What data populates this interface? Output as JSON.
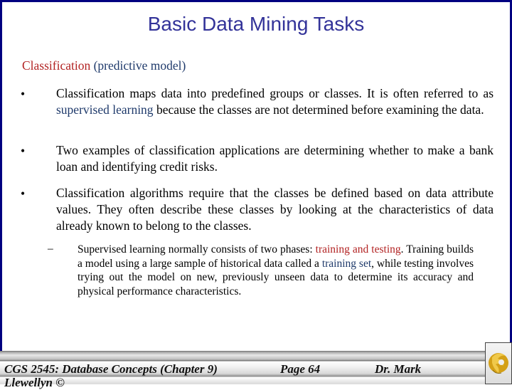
{
  "slide": {
    "title": "Basic Data Mining Tasks",
    "subtitle": {
      "term": "Classification",
      "qualifier": "(predictive model)"
    },
    "bullets": [
      {
        "symbol": "•",
        "before": "Classification maps data into predefined groups or classes.  It is often referred to as ",
        "highlight": "supervised learning",
        "after": " because the classes are not determined before examining the data."
      },
      {
        "symbol": "•",
        "text": "Two examples of classification applications are determining whether to make a bank loan and identifying credit risks."
      },
      {
        "symbol": "•",
        "text": "Classification algorithms require that the classes be defined based on data attribute values.  They often describe these classes by looking at the characteristics of data already known to belong to the classes."
      }
    ],
    "sub_bullet": {
      "symbol": "–",
      "part1": "Supervised learning normally consists of two phases: ",
      "highlight1": "training and testing",
      "part2": ".  Training builds a model using a large sample of historical data called a ",
      "highlight2": "training set",
      "part3": ", while testing involves trying out the model on new, previously unseen data to determine its accuracy and physical performance characteristics."
    }
  },
  "footer": {
    "course": "CGS 2545: Database Concepts  (Chapter 9)",
    "page": "Page 64",
    "author": "Dr. Mark",
    "author_cut": "Llewellyn ©",
    "logo_icon": "university-pegasus-logo"
  },
  "colors": {
    "frame": "#000080",
    "title": "#333399",
    "highlight_red": "#b22222",
    "highlight_blue": "#1f3a6b"
  }
}
